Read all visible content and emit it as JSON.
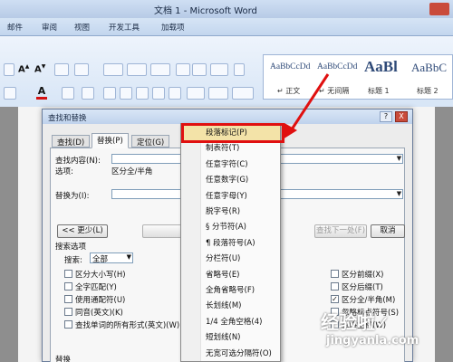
{
  "window": {
    "title": "文档 1 - Microsoft Word"
  },
  "ribbon": {
    "tabs": [
      "邮件",
      "审阅",
      "视图",
      "开发工具",
      "加载项"
    ],
    "styles": [
      {
        "sample": "AaBbCcDd",
        "name": "↵ 正文"
      },
      {
        "sample": "AaBbCcDd",
        "name": "↵ 无间隔"
      },
      {
        "sample": "AaBl",
        "name": "标题 1"
      },
      {
        "sample": "AaBbC",
        "name": "标题 2"
      }
    ]
  },
  "dialog": {
    "title": "查找和替换",
    "help": "?",
    "close": "X",
    "tabs": [
      "查找(D)",
      "替换(P)",
      "定位(G)"
    ],
    "find_label": "查找内容(N):",
    "options_label": "选项:",
    "options_value": "区分全/半角",
    "replace_label": "替换为(I):",
    "less_button": "<< 更少(L)",
    "replace_button": "替换(R)",
    "find_next_button": "查找下一处(F)",
    "cancel_button": "取消",
    "search_options_heading": "搜索选项",
    "search_label": "搜索:",
    "search_value": "全部",
    "left_checks": [
      {
        "label": "区分大小写(H)",
        "checked": false
      },
      {
        "label": "全字匹配(Y)",
        "checked": false
      },
      {
        "label": "使用通配符(U)",
        "checked": false
      },
      {
        "label": "同音(英文)(K)",
        "checked": false
      },
      {
        "label": "查找单词的所有形式(英文)(W)",
        "checked": false
      }
    ],
    "right_checks": [
      {
        "label": "区分前缀(X)",
        "checked": false
      },
      {
        "label": "区分后缀(T)",
        "checked": false
      },
      {
        "label": "区分全/半角(M)",
        "checked": true
      },
      {
        "label": "忽略标点符号(S)",
        "checked": false
      },
      {
        "label": "忽略空格(W)",
        "checked": false
      }
    ],
    "replace_heading": "替换"
  },
  "special_menu": {
    "items": [
      "段落标记(P)",
      "制表符(T)",
      "任意字符(C)",
      "任意数字(G)",
      "任意字母(Y)",
      "脱字号(R)",
      "§ 分节符(A)",
      "¶ 段落符号(A)",
      "分栏符(U)",
      "省略号(E)",
      "全角省略号(F)",
      "长划线(M)",
      "1/4 全角空格(4)",
      "短划线(N)",
      "无宽可选分隔符(O)"
    ],
    "highlighted_index": 0
  },
  "watermark": {
    "line1": "经验啦✓",
    "line2": "jingyanla.com"
  },
  "colors": {
    "highlight_box": "#e01010",
    "menu_highlight": "#f3e3a8",
    "ribbon": "#d7e5f6"
  }
}
